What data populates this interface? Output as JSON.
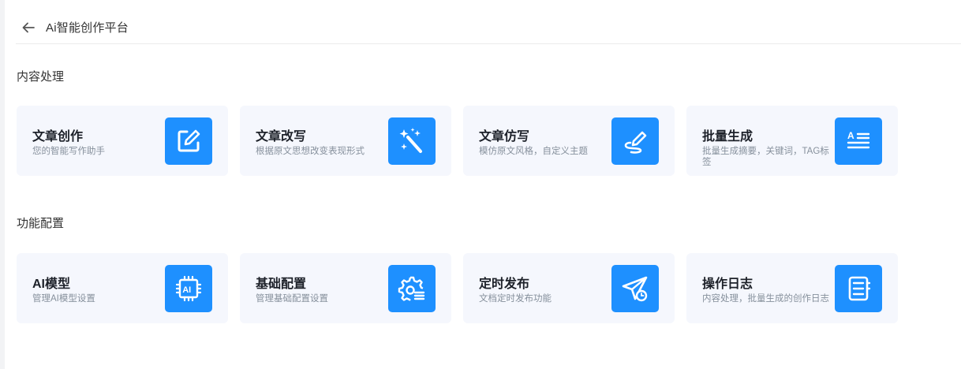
{
  "header": {
    "title": "Ai智能创作平台"
  },
  "sections": [
    {
      "title": "内容处理",
      "cards": [
        {
          "title": "文章创作",
          "desc": "您的智能写作助手",
          "icon": "edit-square-icon"
        },
        {
          "title": "文章改写",
          "desc": "根据原文思想改变表现形式",
          "icon": "magic-wand-icon"
        },
        {
          "title": "文章仿写",
          "desc": "模仿原文风格，自定义主题",
          "icon": "pen-signature-icon"
        },
        {
          "title": "批量生成",
          "desc": "批量生成摘要，关键词，TAG标签",
          "icon": "text-list-icon"
        }
      ]
    },
    {
      "title": "功能配置",
      "cards": [
        {
          "title": "AI模型",
          "desc": "管理AI模型设置",
          "icon": "ai-chip-icon"
        },
        {
          "title": "基础配置",
          "desc": "管理基础配置设置",
          "icon": "gear-settings-icon"
        },
        {
          "title": "定时发布",
          "desc": "文档定时发布功能",
          "icon": "paper-plane-clock-icon"
        },
        {
          "title": "操作日志",
          "desc": "内容处理，批量生成的创作日志",
          "icon": "notebook-log-icon"
        }
      ]
    }
  ],
  "colors": {
    "accent": "#1e90ff",
    "card_bg": "#f5f7fd"
  }
}
